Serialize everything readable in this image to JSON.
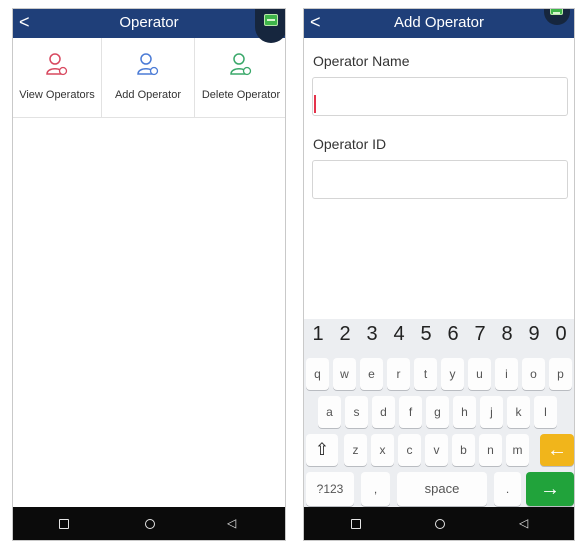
{
  "left": {
    "header_title": "Operator",
    "back_glyph": "<",
    "menu": [
      {
        "label": "View Operators",
        "icon": "user-view-icon",
        "color": "#d8485f"
      },
      {
        "label": "Add Operator",
        "icon": "user-add-icon",
        "color": "#4b7bd6"
      },
      {
        "label": "Delete Operator",
        "icon": "user-delete-icon",
        "color": "#3aa86a"
      }
    ]
  },
  "right": {
    "header_title": "Add Operator",
    "back_glyph": "<",
    "operator_name_label": "Operator Name",
    "operator_name_value": "",
    "operator_id_label": "Operator ID",
    "operator_id_value": ""
  },
  "keyboard": {
    "numbers": [
      "1",
      "2",
      "3",
      "4",
      "5",
      "6",
      "7",
      "8",
      "9",
      "0"
    ],
    "row1": [
      "q",
      "w",
      "e",
      "r",
      "t",
      "y",
      "u",
      "i",
      "o",
      "p"
    ],
    "row2": [
      "a",
      "s",
      "d",
      "f",
      "g",
      "h",
      "j",
      "k",
      "l"
    ],
    "row3": [
      "z",
      "x",
      "c",
      "v",
      "b",
      "n",
      "m"
    ],
    "shift": "⇧",
    "backspace": "←",
    "symbols": "?123",
    "comma": ",",
    "space": "space",
    "period": ".",
    "enter": "→"
  },
  "colors": {
    "header": "#1f3f79",
    "nav": "#0b0b0b",
    "backspace_key": "#f1b51b",
    "enter_key": "#21a33b",
    "cursor": "#e4334b"
  }
}
